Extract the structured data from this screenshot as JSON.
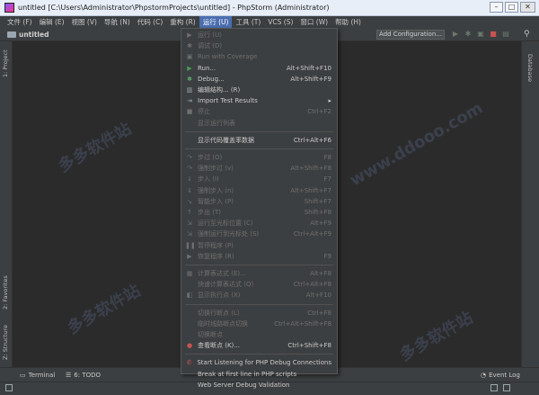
{
  "window": {
    "title": "untitled [C:\\Users\\Administrator\\PhpstormProjects\\untitled] - PhpStorm (Administrator)",
    "min": "–",
    "max": "□",
    "close": "✕"
  },
  "menubar": [
    "文件 (F)",
    "编辑 (E)",
    "视图 (V)",
    "导航 (N)",
    "代码 (C)",
    "重构 (R)",
    "运行 (U)",
    "工具 (T)",
    "VCS (S)",
    "窗口 (W)",
    "帮助 (H)"
  ],
  "navbar": {
    "project": "untitled",
    "add_config": "Add Configuration..."
  },
  "left_panel": {
    "project": "1: Project",
    "favorites": "2: Favorites",
    "structure": "Z: Structure"
  },
  "right_panel": {
    "database": "Database"
  },
  "bottom": {
    "terminal": "Terminal",
    "todo": "6: TODO",
    "event_log": "Event Log"
  },
  "run_menu": [
    {
      "icon": "run-icon",
      "label": "运行 (U)",
      "shortcut": "",
      "enabled": false
    },
    {
      "icon": "debug-icon",
      "label": "调试 (D)",
      "shortcut": "",
      "enabled": false
    },
    {
      "icon": "coverage-icon",
      "label": "Run with Coverage",
      "shortcut": "",
      "enabled": false
    },
    {
      "icon": "run-icon",
      "label": "Run...",
      "shortcut": "Alt+Shift+F10",
      "enabled": true
    },
    {
      "icon": "debug-icon",
      "label": "Debug...",
      "shortcut": "Alt+Shift+F9",
      "enabled": true
    },
    {
      "icon": "edit-config-icon",
      "label": "编辑结构... (R)",
      "shortcut": "",
      "enabled": true
    },
    {
      "icon": "import-icon",
      "label": "Import Test Results",
      "shortcut": "▸",
      "enabled": true
    },
    {
      "icon": "stop-icon",
      "label": "停止",
      "shortcut": "Ctrl+F2",
      "enabled": false
    },
    {
      "icon": "",
      "label": "显示运行列表",
      "shortcut": "",
      "enabled": false
    },
    {
      "sep": true
    },
    {
      "icon": "",
      "label": "显示代码覆盖率数据",
      "shortcut": "Ctrl+Alt+F6",
      "enabled": true,
      "highlight": false
    },
    {
      "sep": true
    },
    {
      "icon": "step-over-icon",
      "label": "步过 (O)",
      "shortcut": "F8",
      "enabled": false
    },
    {
      "icon": "force-step-over-icon",
      "label": "强制步过 (v)",
      "shortcut": "Alt+Shift+F8",
      "enabled": false
    },
    {
      "icon": "step-into-icon",
      "label": "步入 (I)",
      "shortcut": "F7",
      "enabled": false
    },
    {
      "icon": "force-step-into-icon",
      "label": "强制步入 (n)",
      "shortcut": "Alt+Shift+F7",
      "enabled": false
    },
    {
      "icon": "smart-step-into-icon",
      "label": "智能步入 (P)",
      "shortcut": "Shift+F7",
      "enabled": false
    },
    {
      "icon": "step-out-icon",
      "label": "步出 (T)",
      "shortcut": "Shift+F8",
      "enabled": false
    },
    {
      "icon": "run-to-cursor-icon",
      "label": "运行至光标位置 (C)",
      "shortcut": "Alt+F9",
      "enabled": false
    },
    {
      "icon": "force-run-to-cursor-icon",
      "label": "强制运行到光标处 (S)",
      "shortcut": "Ctrl+Alt+F9",
      "enabled": false
    },
    {
      "icon": "pause-icon",
      "label": "暂停程序 (P)",
      "shortcut": "",
      "enabled": false
    },
    {
      "icon": "resume-icon",
      "label": "恢复程序 (R)",
      "shortcut": "F9",
      "enabled": false
    },
    {
      "sep": true
    },
    {
      "icon": "evaluate-icon",
      "label": "计算表达式 (E)...",
      "shortcut": "Alt+F8",
      "enabled": false
    },
    {
      "icon": "",
      "label": "快速计算表达式 (Q)",
      "shortcut": "Ctrl+Alt+F8",
      "enabled": false
    },
    {
      "icon": "show-exec-point-icon",
      "label": "显示执行点 (X)",
      "shortcut": "Alt+F10",
      "enabled": false
    },
    {
      "sep": true
    },
    {
      "icon": "",
      "label": "切换行断点 (L)",
      "shortcut": "Ctrl+F8",
      "enabled": false
    },
    {
      "icon": "",
      "label": "临时线路断点切换",
      "shortcut": "Ctrl+Alt+Shift+F8",
      "enabled": false
    },
    {
      "icon": "",
      "label": "切换断点",
      "shortcut": "",
      "enabled": false
    },
    {
      "icon": "breakpoints-icon",
      "label": "查看断点 (K)...",
      "shortcut": "Ctrl+Shift+F8",
      "enabled": true
    },
    {
      "sep": true
    },
    {
      "icon": "php-debug-icon",
      "label": "Start Listening for PHP Debug Connections",
      "shortcut": "",
      "enabled": true
    },
    {
      "icon": "",
      "label": "Break at first line in PHP scripts",
      "shortcut": "",
      "enabled": true
    },
    {
      "icon": "",
      "label": "Web Server Debug Validation",
      "shortcut": "",
      "enabled": true
    }
  ],
  "colors": {
    "accent": "#4b6eaf",
    "run_green": "#499c54",
    "debug_green": "#59a869",
    "stop_red": "#c75450"
  }
}
